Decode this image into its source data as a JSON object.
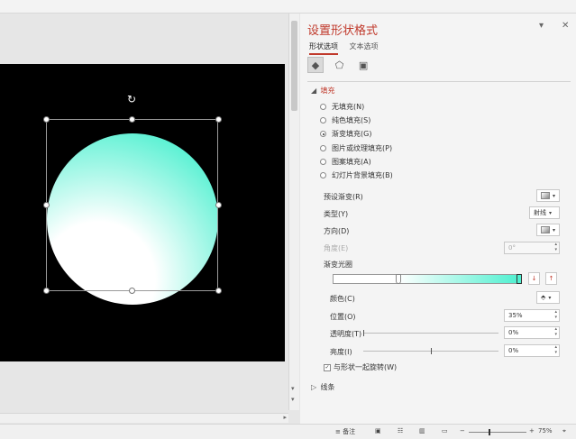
{
  "panel": {
    "title": "设置形状格式",
    "tabs": [
      {
        "label": "形状选项",
        "active": true
      },
      {
        "label": "文本选项",
        "active": false
      }
    ],
    "icons": [
      "fill-line-icon",
      "effects-icon",
      "size-properties-icon"
    ]
  },
  "fill": {
    "section_label": "填充",
    "options": [
      {
        "label": "无填充(N)",
        "selected": false
      },
      {
        "label": "纯色填充(S)",
        "selected": false
      },
      {
        "label": "渐变填充(G)",
        "selected": true
      },
      {
        "label": "图片或纹理填充(P)",
        "selected": false
      },
      {
        "label": "图案填充(A)",
        "selected": false
      },
      {
        "label": "幻灯片背景填充(B)",
        "selected": false
      }
    ],
    "preset_label": "预设渐变(R)",
    "type_label": "类型(Y)",
    "type_value": "射线",
    "direction_label": "方向(D)",
    "angle_label": "角度(E)",
    "angle_value": "0°",
    "stops_label": "渐变光圈",
    "color_label": "颜色(C)",
    "position_label": "位置(O)",
    "position_value": "35%",
    "transparency_label": "透明度(T)",
    "transparency_value": "0%",
    "brightness_label": "亮度(I)",
    "brightness_value": "0%",
    "rotate_label": "与形状一起旋转(W)",
    "rotate_checked": true,
    "gradient_colors": [
      "#ffffff",
      "#4ff0d0"
    ],
    "stop_positions_percent": [
      35,
      100
    ]
  },
  "line": {
    "section_label": "线条"
  },
  "statusbar": {
    "notes_label": "备注",
    "zoom_value": "75%"
  },
  "colors": {
    "accent": "#c0392b",
    "circle_start": "#ffffff",
    "circle_end": "#4ff0d0"
  }
}
